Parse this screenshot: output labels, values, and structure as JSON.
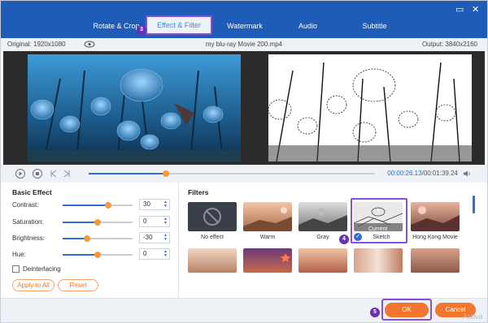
{
  "header": {
    "tabs": [
      {
        "label": "Rotate & Crop"
      },
      {
        "label": "Effect & Filter"
      },
      {
        "label": "Watermark"
      },
      {
        "label": "Audio"
      },
      {
        "label": "Subtitle"
      }
    ],
    "active_tab": 1,
    "step_badges": [
      "3",
      "4",
      "5"
    ]
  },
  "infobar": {
    "original": "Original: 1920x1080",
    "filename": "my blu-ray Movie 200.mp4",
    "output": "Output: 3840x2160"
  },
  "playback": {
    "current_time": "00:00:26.13",
    "total_time": "/00:01:39.24",
    "progress": 0.27
  },
  "basic_effect": {
    "title": "Basic Effect",
    "contrast": {
      "label": "Contrast:",
      "value": "30",
      "level": 0.65
    },
    "saturation": {
      "label": "Saturation:",
      "value": "0",
      "level": 0.5
    },
    "brightness": {
      "label": "Brightness:",
      "value": "-30",
      "level": 0.35
    },
    "hue": {
      "label": "Hue:",
      "value": "0",
      "level": 0.5
    },
    "deinterlacing_label": "Deinterlacing",
    "apply_all_label": "Apply to All",
    "reset_label": "Reset"
  },
  "filters": {
    "title": "Filters",
    "row1": [
      {
        "label": "No effect"
      },
      {
        "label": "Warm"
      },
      {
        "label": "Gray"
      },
      {
        "label": "Sketch"
      },
      {
        "label": "Hong Kong Movie"
      }
    ],
    "current_label": "Current"
  },
  "footer": {
    "ok_label": "OK",
    "cancel_label": "Cancel",
    "watermark_text": "Activa"
  },
  "colors": {
    "header_bg": "#1e5cb8",
    "accent": "#2f6fd3",
    "orange": "#f39a3a",
    "highlight": "#8a4fd8"
  }
}
